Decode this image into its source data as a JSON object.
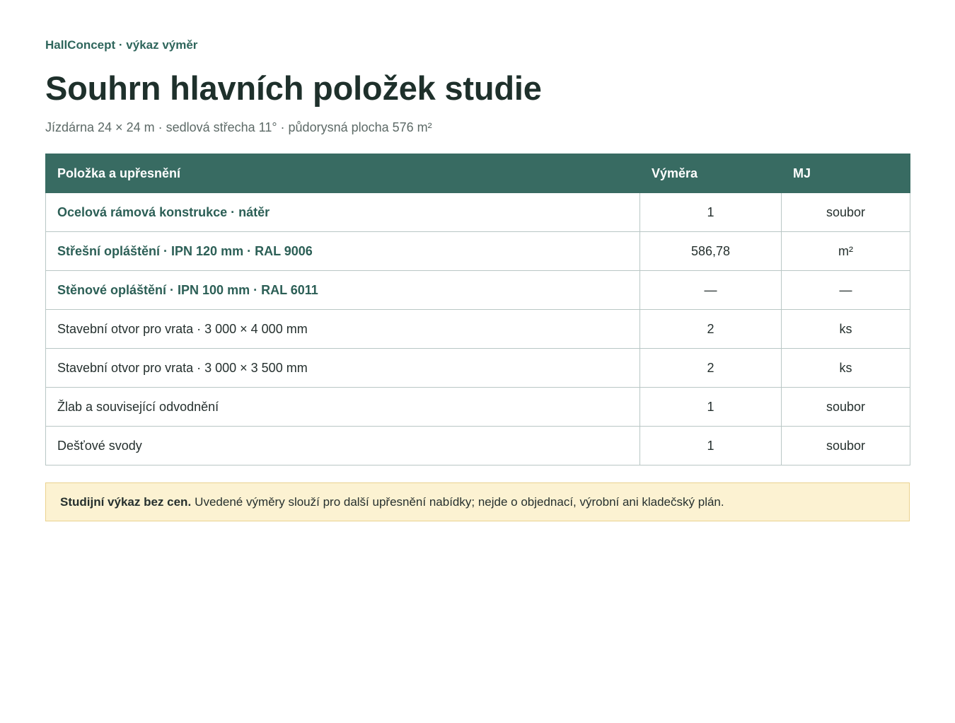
{
  "header": {
    "eyebrow": "HallConcept · výkaz výměr",
    "title": "Souhrn hlavních položek studie",
    "subtitle": "Jízdárna 24 × 24 m · sedlová střecha 11° · půdorysná plocha 576 m²"
  },
  "table": {
    "columns": {
      "item": "Položka a upřesnění",
      "quantity": "Výměra",
      "unit": "MJ"
    },
    "rows": [
      {
        "item": "Ocelová rámová konstrukce · nátěr",
        "quantity": "1",
        "unit": "soubor",
        "emphasis": true
      },
      {
        "item": "Střešní opláštění · IPN 120 mm · RAL 9006",
        "quantity": "586,78",
        "unit": "m²",
        "emphasis": true
      },
      {
        "item": "Stěnové opláštění · IPN 100 mm · RAL 6011",
        "quantity": "—",
        "unit": "—",
        "emphasis": true
      },
      {
        "item": "Stavební otvor pro vrata · 3 000 × 4 000 mm",
        "quantity": "2",
        "unit": "ks",
        "emphasis": false
      },
      {
        "item": "Stavební otvor pro vrata · 3 000 × 3 500 mm",
        "quantity": "2",
        "unit": "ks",
        "emphasis": false
      },
      {
        "item": "Žlab a související odvodnění",
        "quantity": "1",
        "unit": "soubor",
        "emphasis": false
      },
      {
        "item": "Dešťové svody",
        "quantity": "1",
        "unit": "soubor",
        "emphasis": false
      }
    ]
  },
  "note": {
    "strong": "Studijní výkaz bez cen.",
    "text": "Uvedené výměry slouží pro další upřesnění nabídky; nejde o objednací, výrobní ani kladečský plán."
  },
  "colors": {
    "accent": "#386b62",
    "accent_text": "#2c5f56",
    "note_background": "#fcf2d2",
    "note_border": "#ead28f"
  }
}
